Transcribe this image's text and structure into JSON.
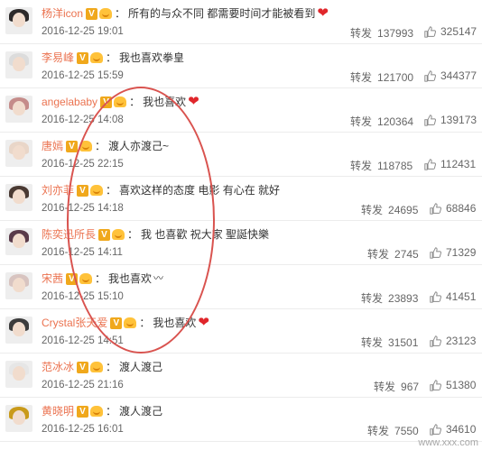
{
  "comments": [
    {
      "name": "杨洋icon",
      "text": "所有的与众不同 都需要时间才能被看到",
      "end_icon": "heart-icon",
      "date": "2016-12-25 19:01",
      "repost_label": "转发",
      "reposts": "137993",
      "likes": "325147",
      "avatar_color": "#2d2a2a"
    },
    {
      "name": "李易峰",
      "text": "我也喜欢拳皇",
      "end_icon": "",
      "date": "2016-12-25 15:59",
      "repost_label": "转发",
      "reposts": "121700",
      "likes": "344377",
      "avatar_color": "#dcdcdc"
    },
    {
      "name": "angelababy",
      "text": "我也喜欢",
      "end_icon": "heart-icon",
      "date": "2016-12-25 14:08",
      "repost_label": "转发",
      "reposts": "120364",
      "likes": "139173",
      "avatar_color": "#c58c8a"
    },
    {
      "name": "唐嫣",
      "text": "渡人亦渡己~",
      "end_icon": "",
      "date": "2016-12-25 22:15",
      "repost_label": "转发",
      "reposts": "118785",
      "likes": "112431",
      "avatar_color": "#e9d6c8"
    },
    {
      "name": "刘亦菲",
      "text": "喜欢这样的态度 电影 有心在 就好",
      "end_icon": "",
      "date": "2016-12-25 14:18",
      "repost_label": "转发",
      "reposts": "24695",
      "likes": "68846",
      "avatar_color": "#4a3a33"
    },
    {
      "name": "陈奕迅所長",
      "text": "我 也喜歡 祝大家 聖誕快樂",
      "end_icon": "",
      "date": "2016-12-25 14:11",
      "repost_label": "转发",
      "reposts": "2745",
      "likes": "71329",
      "avatar_color": "#5a3b4a"
    },
    {
      "name": "宋茜",
      "text": "我也喜欢",
      "end_icon": "emoji-icon",
      "date": "2016-12-25 15:10",
      "repost_label": "转发",
      "reposts": "23893",
      "likes": "41451",
      "avatar_color": "#d8c4c0"
    },
    {
      "name": "Crystal张天爱",
      "text": "我也喜欢",
      "end_icon": "heart-icon",
      "date": "2016-12-25 14:51",
      "repost_label": "转发",
      "reposts": "31501",
      "likes": "23123",
      "avatar_color": "#3c3c3c"
    },
    {
      "name": "范冰冰",
      "text": "渡人渡己",
      "end_icon": "",
      "date": "2016-12-25 21:16",
      "repost_label": "转发",
      "reposts": "967",
      "likes": "51380",
      "avatar_color": "#e6e6e6"
    },
    {
      "name": "黄晓明",
      "text": "渡人渡己",
      "end_icon": "",
      "date": "2016-12-25 16:01",
      "repost_label": "转发",
      "reposts": "7550",
      "likes": "34610",
      "avatar_color": "#c99a1a"
    }
  ],
  "colors": {
    "name": "#eb7350",
    "circle": "#d9534f",
    "heart": "#e0262b"
  },
  "watermark": "www.xxx.com"
}
